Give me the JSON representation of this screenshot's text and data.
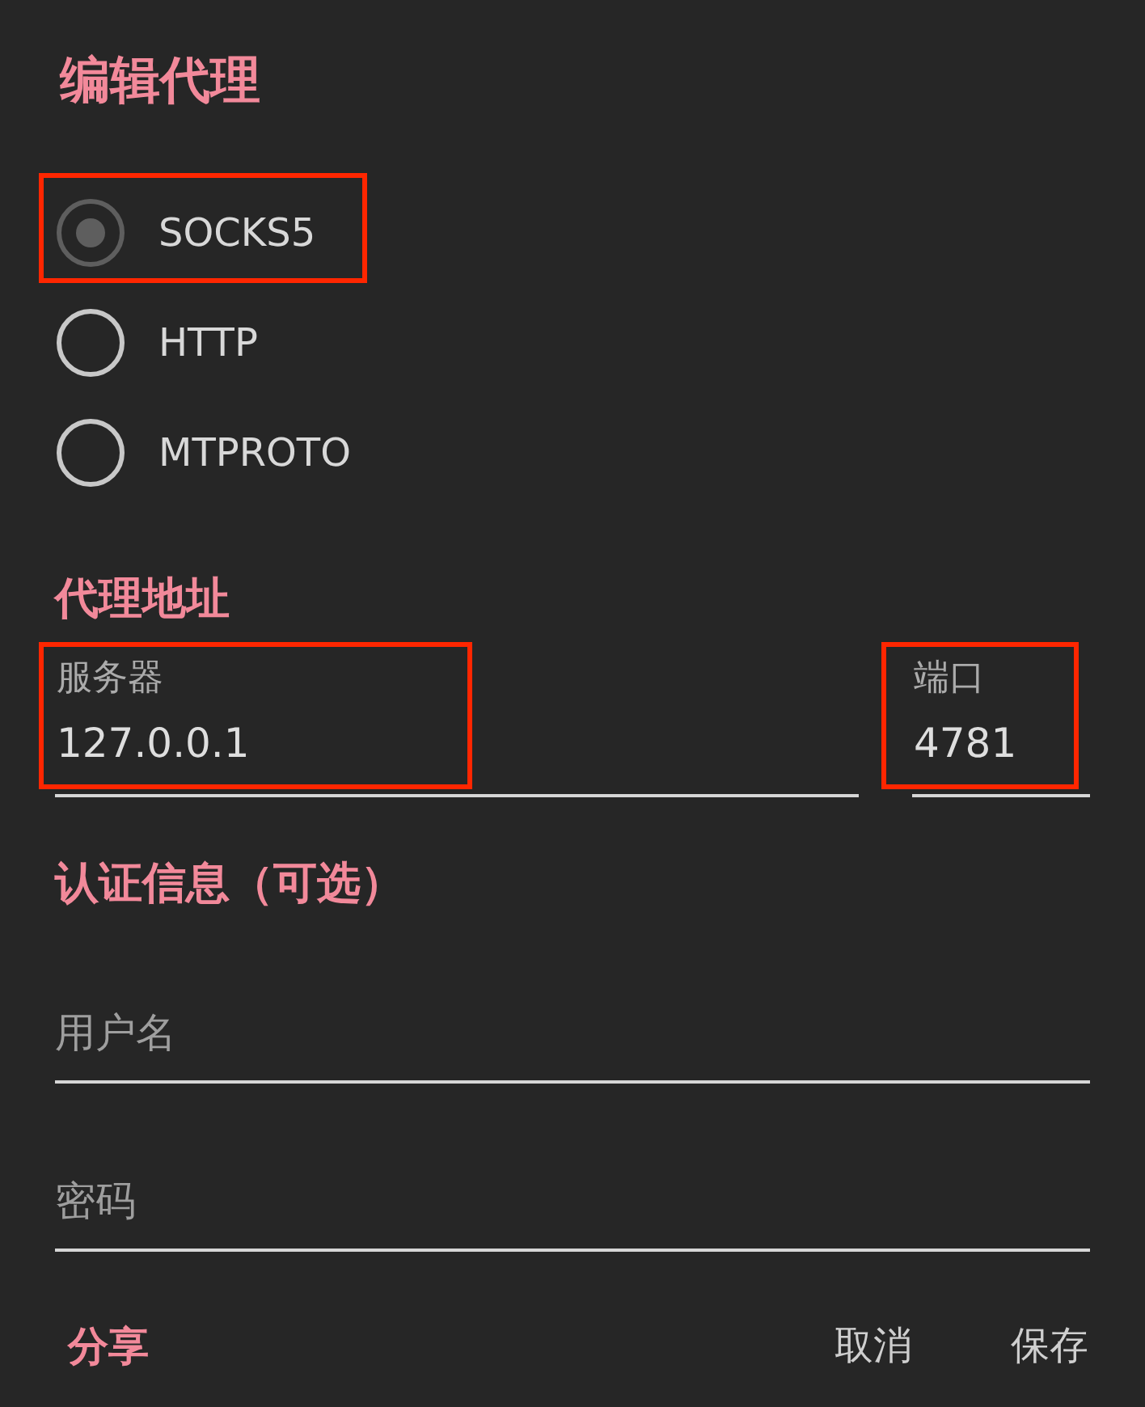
{
  "dialog": {
    "title": "编辑代理"
  },
  "proxy_types": [
    {
      "label": "SOCKS5",
      "selected": true,
      "highlighted": true
    },
    {
      "label": "HTTP",
      "selected": false,
      "highlighted": false
    },
    {
      "label": "MTPROTO",
      "selected": false,
      "highlighted": false
    }
  ],
  "address_section": {
    "heading": "代理地址",
    "fields": [
      {
        "label": "服务器",
        "value": "127.0.0.1",
        "highlighted": true
      },
      {
        "label": "端口",
        "value": "4781",
        "highlighted": true
      }
    ]
  },
  "auth_section": {
    "heading": "认证信息（可选）",
    "fields": [
      {
        "placeholder": "用户名"
      },
      {
        "placeholder": "密码"
      }
    ]
  },
  "footer_buttons": [
    {
      "label": "分享",
      "kind": "accent"
    },
    {
      "label": "取消",
      "kind": "plain"
    },
    {
      "label": "保存",
      "kind": "plain"
    }
  ]
}
